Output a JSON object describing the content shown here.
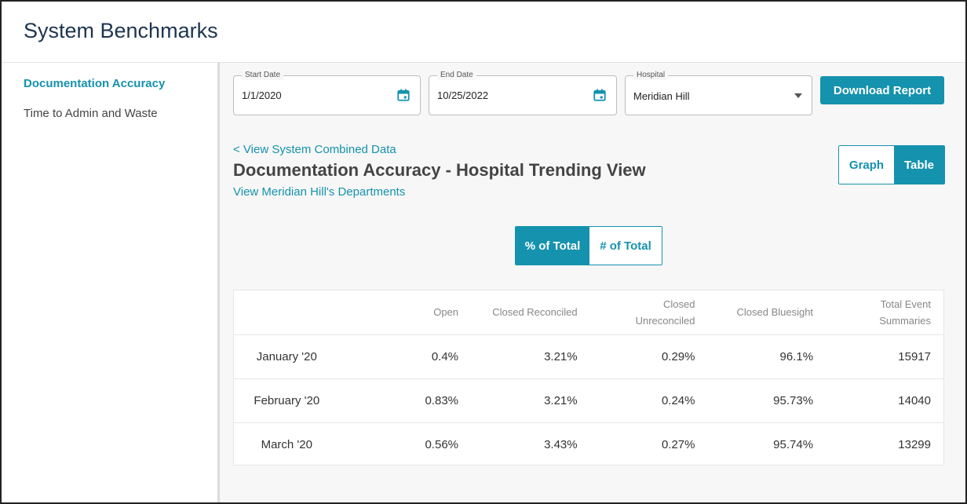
{
  "app": {
    "title": "System Benchmarks"
  },
  "sidebar": {
    "items": [
      {
        "label": "Documentation Accuracy"
      },
      {
        "label": "Time to Admin and Waste"
      }
    ]
  },
  "filters": {
    "start_date": {
      "label": "Start Date",
      "value": "1/1/2020"
    },
    "end_date": {
      "label": "End Date",
      "value": "10/25/2022"
    },
    "hospital": {
      "label": "Hospital",
      "value": "Meridian Hill"
    },
    "download_label": "Download Report"
  },
  "content": {
    "back_link": "< View System Combined Data",
    "title": "Documentation Accuracy - Hospital Trending View",
    "departments_link": "View Meridian Hill's Departments",
    "view_toggle": {
      "graph": "Graph",
      "table": "Table",
      "selected": "Table"
    },
    "metric_toggle": {
      "percent": "% of Total",
      "count": "# of Total",
      "selected": "% of Total"
    }
  },
  "table": {
    "columns": [
      "",
      "Open",
      "Closed Reconciled",
      "Closed Unreconciled",
      "Closed Bluesight",
      "Total Event Summaries"
    ],
    "rows": [
      [
        "January '20",
        "0.4%",
        "3.21%",
        "0.29%",
        "96.1%",
        "15917"
      ],
      [
        "February '20",
        "0.83%",
        "3.21%",
        "0.24%",
        "95.73%",
        "14040"
      ],
      [
        "March '20",
        "0.56%",
        "3.43%",
        "0.27%",
        "95.74%",
        "13299"
      ]
    ]
  },
  "colors": {
    "accent": "#1592ad",
    "title": "#1e3550"
  }
}
